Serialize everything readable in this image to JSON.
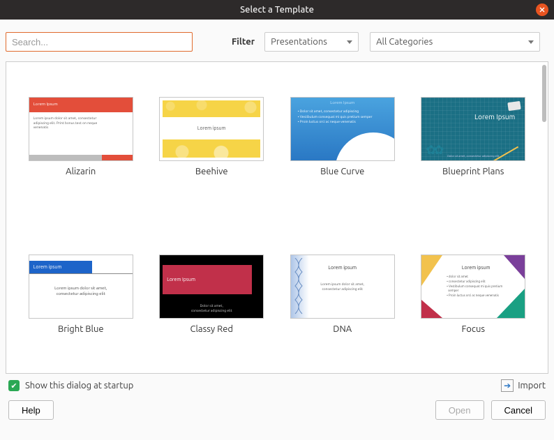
{
  "title": "Select a Template",
  "search": {
    "placeholder": "Search..."
  },
  "filter": {
    "label": "Filter",
    "app_value": "Presentations",
    "cat_value": "All Categories"
  },
  "templates": [
    {
      "name": "Alizarin"
    },
    {
      "name": "Beehive"
    },
    {
      "name": "Blue Curve"
    },
    {
      "name": "Blueprint Plans"
    },
    {
      "name": "Bright Blue"
    },
    {
      "name": "Classy Red"
    },
    {
      "name": "DNA"
    },
    {
      "name": "Focus"
    }
  ],
  "thumb_text": {
    "lorem_title": "Lorem Ipsum",
    "lorem_title_lc": "Lorem ipsum",
    "alizarin_body": "Lorem ipsum dolor sit amet, consectetur adipiscing elit.\nPrint bonus text on neque venenatis",
    "bluecurve_bullets": "• Dolor sit amet, consectetur adipiscing\n• Vestibulum consequat mi quis pretium semper\n• Proin luctus orci ac neque venenatis",
    "blueprint_foot": "Dolor sit amet, consectetur adipiscing elit",
    "brightblue_body": "Lorem ipsum dolor sit amet,\nconsectetur adipiscing elit",
    "classyred_body": "Dolor sit amet,\nconsectetur adipiscing elit",
    "dna_body": "Lorem ipsum dolor sit amet,\nconsectetur adipiscing elit",
    "focus_bullets": "• dolor sit amet\n• consectetur adipiscing elit\n• Vestibulum consequat mi quis pretium\n  semper\n• Proin luctus orci ac neque venenatis"
  },
  "footer": {
    "show_at_startup": "Show this dialog at startup",
    "import": "Import",
    "help": "Help",
    "open": "Open",
    "cancel": "Cancel"
  }
}
